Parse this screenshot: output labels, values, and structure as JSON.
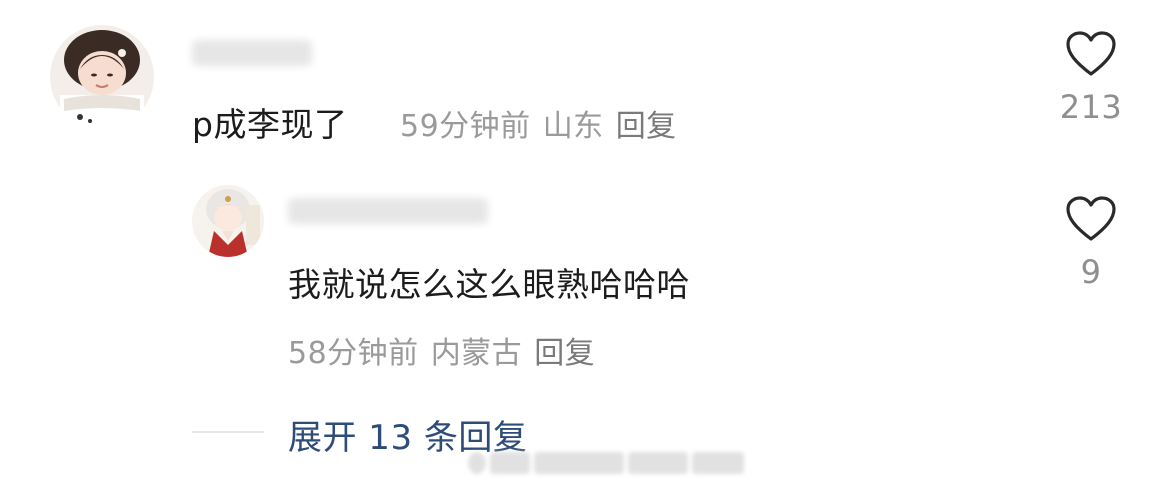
{
  "comments": [
    {
      "text": "p成李现了",
      "time": "59分钟前",
      "location": "山东",
      "reply_label": "回复",
      "like_count": "213"
    }
  ],
  "reply": {
    "text": "我就说怎么这么眼熟哈哈哈",
    "time": "58分钟前",
    "location": "内蒙古",
    "reply_label": "回复",
    "like_count": "9"
  },
  "expand": {
    "label": "展开 13 条回复"
  },
  "icons": {
    "like": "heart-outline-icon"
  },
  "colors": {
    "link": "#2e4c78",
    "meta": "#9a9a9a",
    "text": "#1c1c1c"
  }
}
